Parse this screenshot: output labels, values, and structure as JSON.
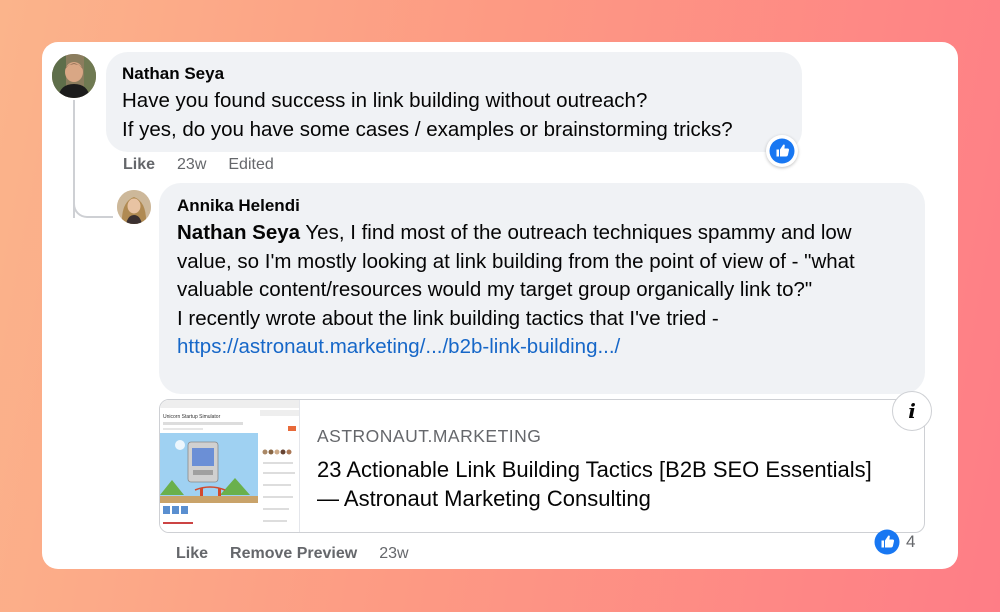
{
  "comment": {
    "author": "Nathan Seya",
    "lines": [
      "Have you found success in link building without outreach?",
      "If yes, do you have some cases / examples or brainstorming tricks?"
    ],
    "like_label": "Like",
    "time": "23w",
    "edited_label": "Edited",
    "reaction_icon": "like-icon"
  },
  "reply": {
    "author": "Annika Helendi",
    "mention": "Nathan Seya",
    "text_after_mention": " Yes, I find most of the outreach techniques spammy and low value, so I'm mostly looking at link building from the point of view of - \"what valuable content/resources would my target group organically link to?\"",
    "text_line2": "I recently wrote about the link building tactics that I've tried -",
    "link": "https://astronaut.marketing/.../b2b-link-building.../",
    "like_label": "Like",
    "remove_preview_label": "Remove Preview",
    "time": "23w",
    "reaction_count": "4"
  },
  "preview": {
    "domain": "ASTRONAUT.MARKETING",
    "title": "23 Actionable Link Building Tactics [B2B SEO Essentials] — Astronaut Marketing Consulting",
    "thumbnail_title": "Unicorn Startup Simulator"
  },
  "colors": {
    "accent": "#1877f2",
    "link": "#1667c8",
    "bubble": "#f0f2f5",
    "meta_text": "#65676b"
  }
}
